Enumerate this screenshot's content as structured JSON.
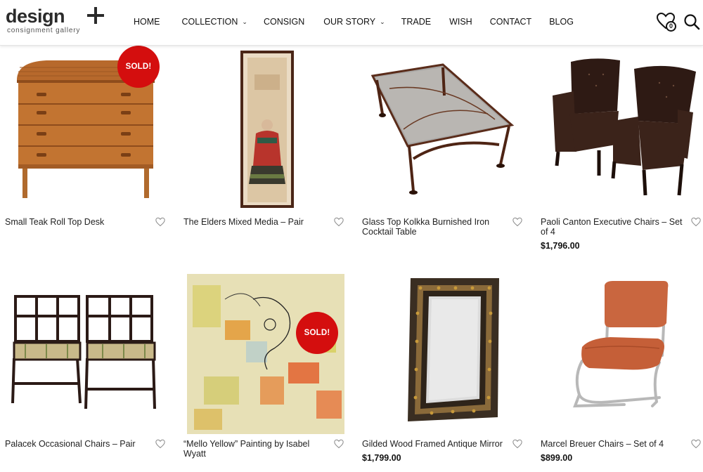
{
  "brand": {
    "name": "design",
    "tagline": "consignment gallery"
  },
  "nav": [
    {
      "label": "HOME"
    },
    {
      "label": "COLLECTION",
      "dropdown": true
    },
    {
      "label": "CONSIGN"
    },
    {
      "label": "OUR STORY",
      "dropdown": true
    },
    {
      "label": "TRADE"
    },
    {
      "label": "WISH"
    },
    {
      "label": "CONTACT"
    },
    {
      "label": "BLOG"
    }
  ],
  "wishlist": {
    "count": "0"
  },
  "colors": {
    "sold_badge": "#d40e0e",
    "heart": "#888888"
  },
  "products": [
    {
      "title": "Small Teak Roll Top Desk",
      "price": "",
      "sold": true,
      "sold_label": "SOLD!"
    },
    {
      "title": "The Elders Mixed Media – Pair",
      "price": "",
      "sold": false
    },
    {
      "title": "Glass Top Kolkka Burnished Iron Cocktail Table",
      "price": "",
      "sold": false
    },
    {
      "title": "Paoli Canton Executive Chairs – Set of 4",
      "price": "$1,796.00",
      "sold": false
    },
    {
      "title": "Palacek Occasional Chairs – Pair",
      "price": "",
      "sold": false
    },
    {
      "title": "“Mello Yellow” Painting by Isabel Wyatt",
      "price": "",
      "sold": true,
      "sold_label": "SOLD!"
    },
    {
      "title": "Gilded Wood Framed Antique Mirror",
      "price": "$1,799.00",
      "sold": false
    },
    {
      "title": "Marcel Breuer Chairs – Set of 4",
      "price": "$899.00",
      "sold": false
    }
  ]
}
